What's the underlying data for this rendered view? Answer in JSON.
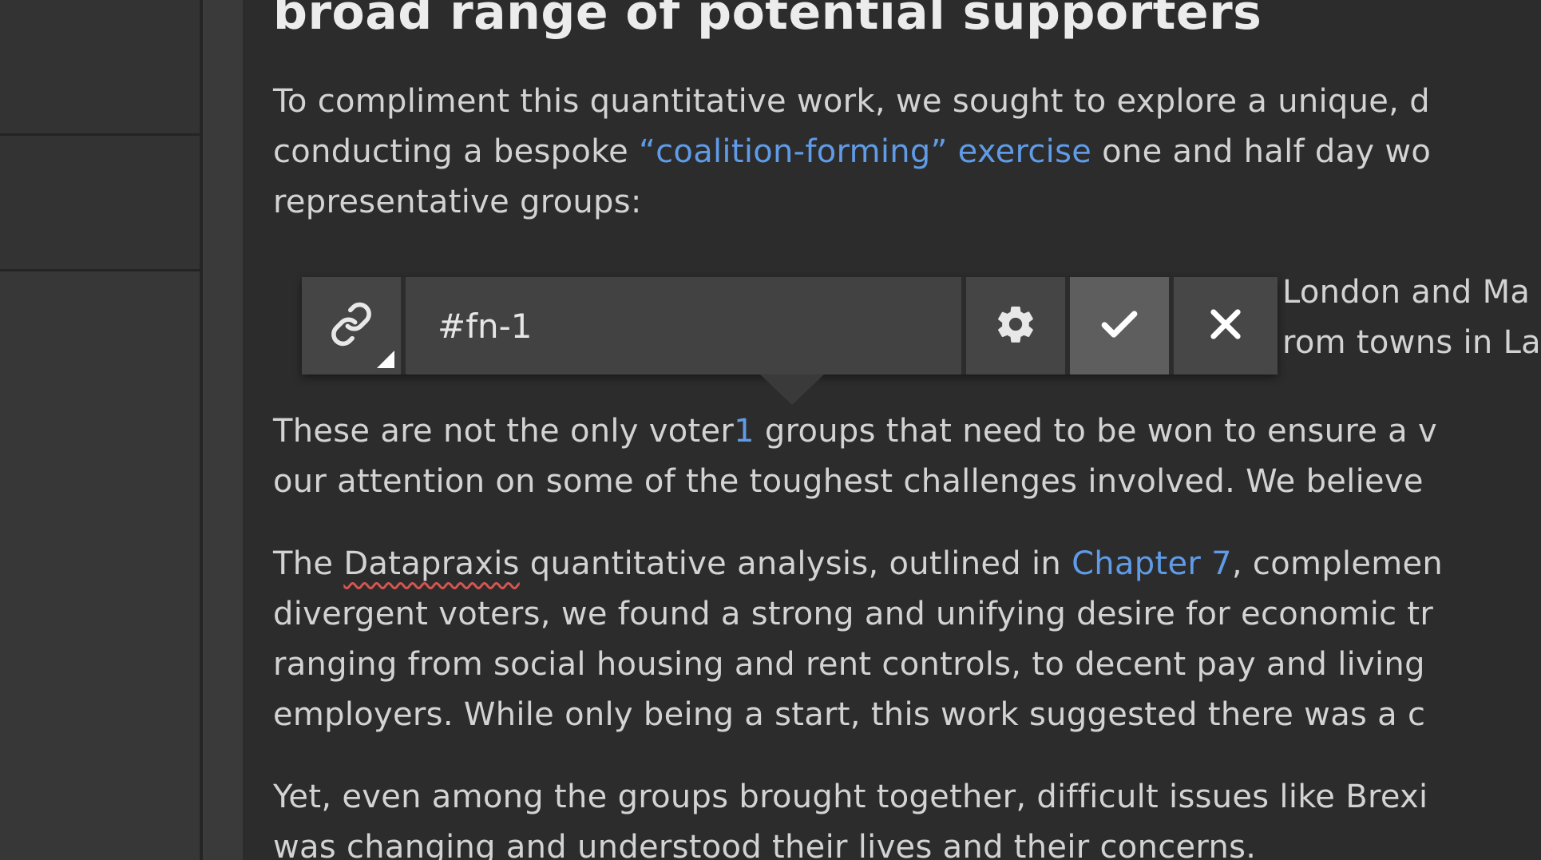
{
  "editor": {
    "heading": "broad range of potential supporters",
    "p1": {
      "line1": "To compliment this quantitative work, we sought to explore a unique, d",
      "line2_before": "conducting a bespoke ",
      "line2_link": "“coalition-forming” exercise",
      "line2_after": " one and half day wo",
      "line3": "representative groups:"
    },
    "list": {
      "line1_hidden": "London and Ma",
      "line2_hidden": "rom towns in La"
    },
    "p2": {
      "line1_before": "These are not the only voter",
      "line1_ref": "1",
      "line1_after": " groups that need to be won to ensure a v",
      "line2": "our attention on some of the toughest challenges involved. We believe"
    },
    "p3": {
      "line1_before": "The ",
      "line1_spell": "Datapraxis",
      "line1_mid": " quantitative analysis, outlined in ",
      "line1_link": "Chapter 7",
      "line1_after": ", complemen",
      "line2": "divergent voters, we found a strong and unifying desire for economic tr",
      "line3": "ranging from social housing and rent controls, to decent pay and living",
      "line4": "employers. While only being a start, this work suggested there was a c"
    },
    "p4": {
      "line1": "Yet, even among the groups brought together, difficult issues like Brexi",
      "line2": "was changing and understood their lives and their concerns."
    }
  },
  "link_popover": {
    "url_value": "#fn-1",
    "link_icon": "link-icon",
    "settings_icon": "gear-icon",
    "confirm_icon": "check-icon",
    "cancel_icon": "close-icon"
  },
  "colors": {
    "link": "#5f9be6",
    "text": "#d3d3d3",
    "background": "#2c2c2c",
    "spellcheck": "#d9534f"
  }
}
